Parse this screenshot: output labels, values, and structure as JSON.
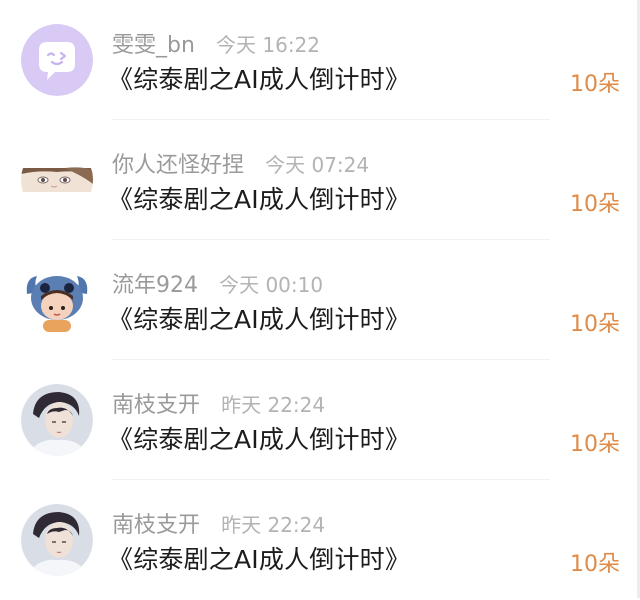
{
  "gift_records": [
    {
      "user": "雯雯_bn",
      "time": "今天 16:22",
      "book": "《综泰剧之AI成人倒计时》",
      "amount": "10朵",
      "avatar_icon": "chat-bubble-avatar-icon",
      "avatar_color": "#d9c9f5"
    },
    {
      "user": "你人还怪好捏",
      "time": "今天 07:24",
      "book": "《综泰剧之AI成人倒计时》",
      "amount": "10朵",
      "avatar_icon": "anime-boy-avatar-icon",
      "avatar_color": "#f1e2d6"
    },
    {
      "user": "流年924",
      "time": "今天 00:10",
      "book": "《综泰剧之AI成人倒计时》",
      "amount": "10朵",
      "avatar_icon": "stitch-hood-avatar-icon",
      "avatar_color": "#5b7fb3"
    },
    {
      "user": "南枝支开",
      "time": "昨天 22:24",
      "book": "《综泰剧之AI成人倒计时》",
      "amount": "10朵",
      "avatar_icon": "portrait-avatar-icon",
      "avatar_color": "#c7ccd6"
    },
    {
      "user": "南枝支开",
      "time": "昨天 22:24",
      "book": "《综泰剧之AI成人倒计时》",
      "amount": "10朵",
      "avatar_icon": "portrait-avatar-icon",
      "avatar_color": "#c7ccd6"
    }
  ],
  "colors": {
    "amount": "#e08a45",
    "name": "#9a9a9a",
    "time": "#b3b3b3",
    "book": "#1c1c1c"
  }
}
